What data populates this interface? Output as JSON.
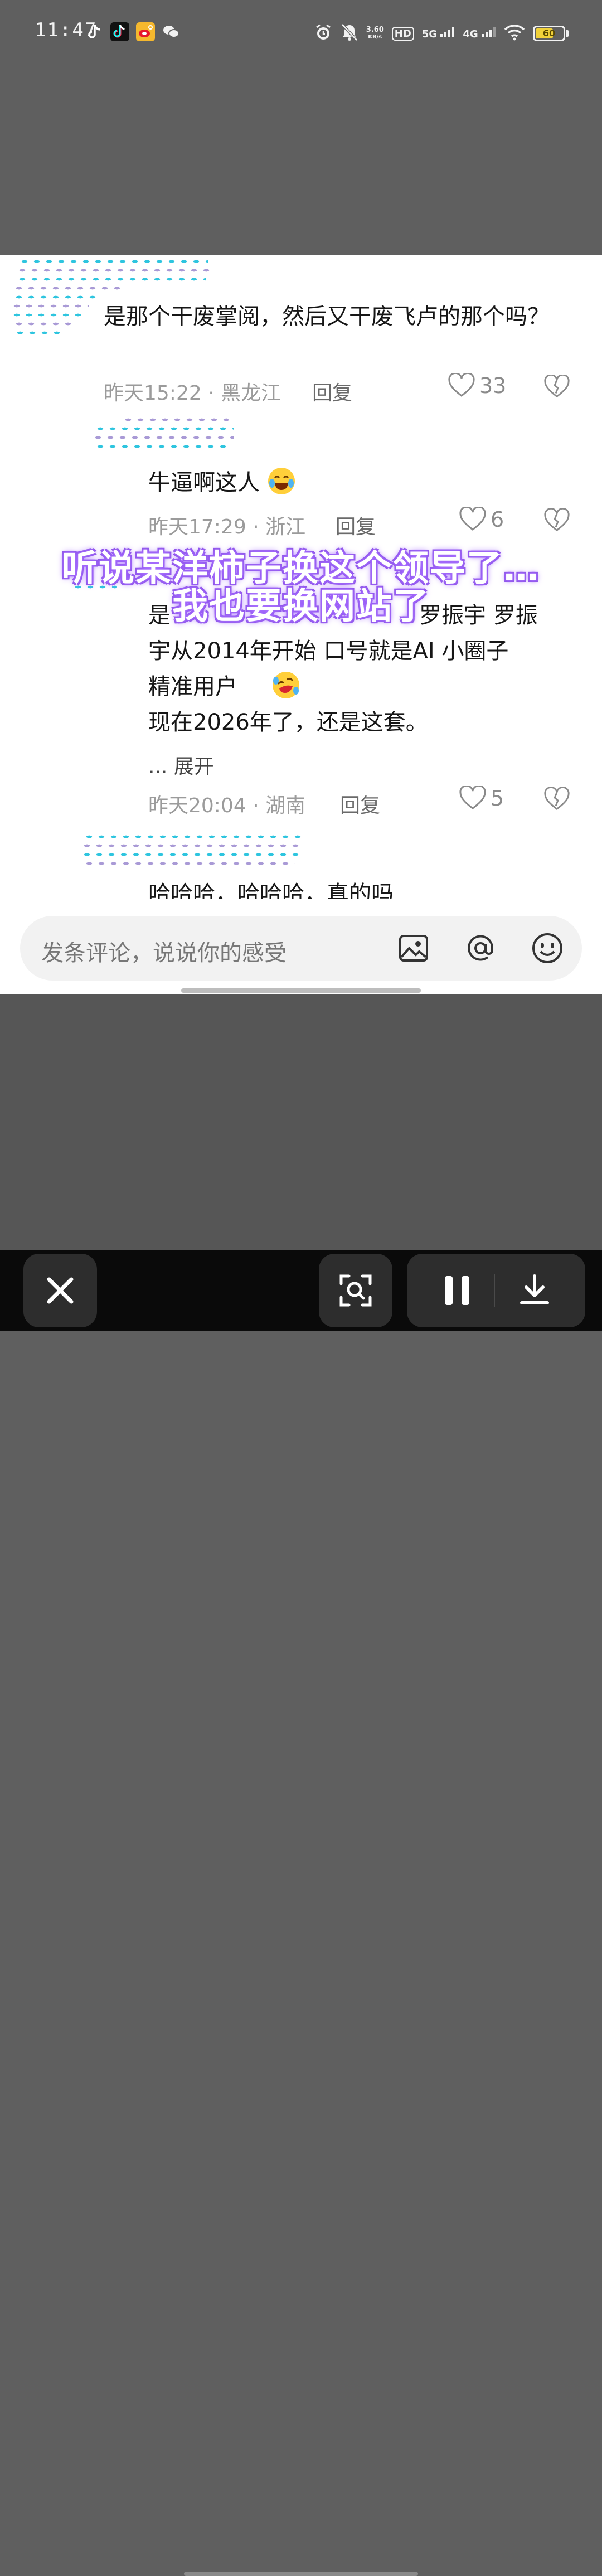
{
  "status_bar": {
    "time": "11:47",
    "net_speed_value": "3.60",
    "net_speed_unit": "KB/s",
    "hd_label": "HD",
    "sim1": "5G",
    "sim2": "4G",
    "battery_level": "60",
    "icons": [
      "tiktok-lite-icon",
      "tiktok-icon",
      "weibo-icon",
      "wechat-icon",
      "alarm-icon",
      "mute-icon",
      "wifi-icon",
      "battery-icon"
    ]
  },
  "comments": [
    {
      "text": "是那个干废掌阅，然后又干废飞卢的那个吗？",
      "time": "昨天15:22",
      "location": "黑龙江",
      "reply_label": "回复",
      "likes": "33"
    },
    {
      "text": "牛逼啊这人",
      "time": "昨天17:29",
      "location": "浙江",
      "reply_label": "回复",
      "likes": "6"
    },
    {
      "line1": "是",
      "line1_end": "罗振宇   罗振",
      "line2": "宇从2014年开始  口号就是AI  小圈子",
      "line3": "精准用户",
      "line4": "现在2026年了，还是这套。",
      "expand_label": "... 展开",
      "time": "昨天20:04",
      "location": "湖南",
      "reply_label": "回复",
      "likes": "5"
    },
    {
      "text": "哈哈哈，哈哈哈，真的吗"
    }
  ],
  "separator": " · ",
  "overlay": {
    "line1": "听说某洋柿子换这个领导了…",
    "line2": "我也要换网站了"
  },
  "input_bar": {
    "placeholder": "发条评论，说说你的感受"
  },
  "colors": {
    "accent_overlay": "#8e55e8",
    "mosaic_blue": "#2ec5df",
    "mosaic_purple": "#a99ad6"
  }
}
